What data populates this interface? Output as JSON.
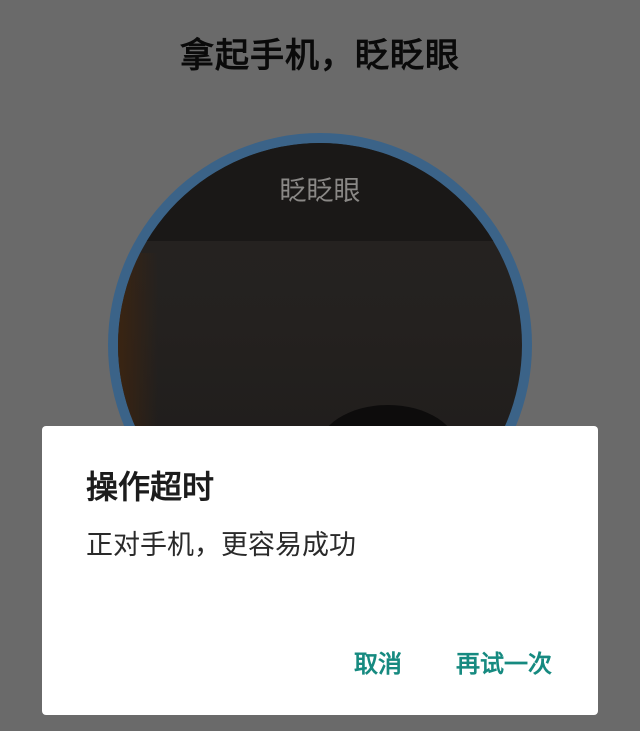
{
  "header": {
    "title": "拿起手机，眨眨眼"
  },
  "camera": {
    "hint": "眨眨眼"
  },
  "dialog": {
    "title": "操作超时",
    "message": "正对手机，更容易成功",
    "cancel_label": "取消",
    "retry_label": "再试一次"
  },
  "colors": {
    "overlay": "#6a6a6a",
    "ring": "#3b6388",
    "accent": "#168a80"
  }
}
